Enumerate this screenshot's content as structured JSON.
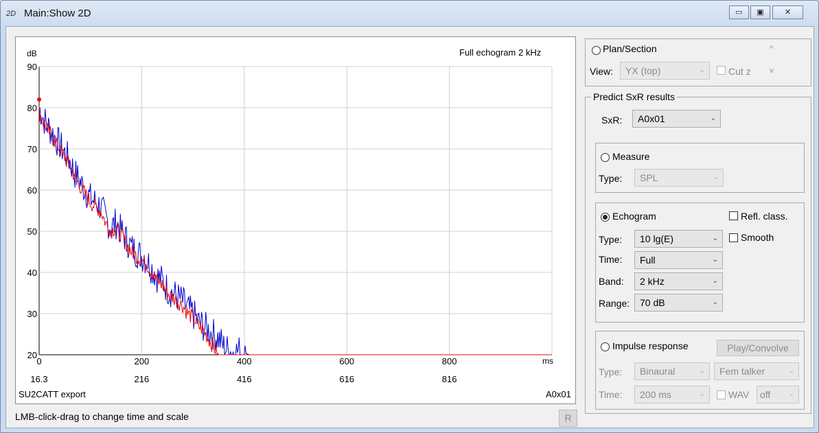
{
  "window": {
    "icon_label": "2D",
    "title": "Main:Show 2D",
    "buttons": {
      "minimize": "▭",
      "maximize": "▣",
      "close": "✕"
    }
  },
  "plot": {
    "title_right": "Full echogram  2 kHz",
    "y_unit": "dB",
    "x_unit": "ms",
    "lower_axis_labels": [
      "16.3",
      "216",
      "416",
      "616",
      "816"
    ],
    "bottom_left_label": "SU2CATT export",
    "bottom_right_label": "A0x01"
  },
  "status": {
    "hint": "LMB-click-drag to change time and scale",
    "r_button": "R"
  },
  "panel": {
    "plan_section": {
      "label": "Plan/Section",
      "view_label": "View:",
      "view_value": "YX (top)",
      "cutz_label": "Cut z",
      "scroll_up": "^",
      "scroll_down": "v"
    },
    "predict": {
      "title": "Predict SxR results",
      "sxr_label": "SxR:",
      "sxr_value": "A0x01"
    },
    "measure": {
      "label": "Measure",
      "type_label": "Type:",
      "type_value": "SPL"
    },
    "echogram": {
      "label": "Echogram",
      "refl_label": "Refl. class.",
      "smooth_label": "Smooth",
      "type_label": "Type:",
      "type_value": "10 lg(E)",
      "time_label": "Time:",
      "time_value": "Full",
      "band_label": "Band:",
      "band_value": "2 kHz",
      "range_label": "Range:",
      "range_value": "70 dB"
    },
    "impulse": {
      "label": "Impulse response",
      "play_button": "Play/Convolve",
      "type_label": "Type:",
      "type_value": "Binaural",
      "talker_value": "Fem talker",
      "time_label": "Time:",
      "time_value": "200 ms",
      "wav_label": "WAV",
      "wav_value": "off"
    }
  },
  "chart_data": {
    "type": "line",
    "title": "Full echogram  2 kHz",
    "xlabel": "ms",
    "ylabel": "dB",
    "xlim": [
      0,
      1000
    ],
    "ylim": [
      20,
      90
    ],
    "x_ticks": [
      0,
      200,
      400,
      600,
      800
    ],
    "y_ticks": [
      20,
      30,
      40,
      50,
      60,
      70,
      80,
      90
    ],
    "grid": true,
    "colors": {
      "blue_series": "#0000cc",
      "red_series": "#ee0000"
    },
    "peak_marker": {
      "x": 0,
      "y": 82
    },
    "series": [
      {
        "color": "#0000cc",
        "x": [
          0,
          10,
          20,
          30,
          40,
          50,
          60,
          70,
          80,
          90,
          100,
          110,
          120,
          130,
          140,
          150,
          160,
          170,
          180,
          190,
          200,
          210,
          220,
          230,
          240,
          250,
          260,
          270,
          280,
          290,
          300,
          310,
          320,
          330,
          340,
          350,
          360,
          370,
          380,
          390,
          400,
          410
        ],
        "y": [
          80,
          77,
          75,
          73,
          71,
          69,
          67,
          64,
          62,
          60,
          58,
          57,
          56,
          53,
          51,
          52,
          50,
          48,
          46,
          45,
          44,
          43,
          41,
          39,
          38,
          36,
          35,
          34,
          33,
          31,
          30,
          28,
          27,
          26,
          25,
          24,
          22,
          21,
          20.5,
          21,
          20.5,
          20
        ]
      },
      {
        "color": "#ee0000",
        "x": [
          0,
          10,
          20,
          30,
          40,
          50,
          60,
          70,
          80,
          90,
          100,
          110,
          120,
          130,
          140,
          150,
          160,
          170,
          180,
          190,
          200,
          210,
          220,
          230,
          240,
          250,
          260,
          270,
          280,
          290,
          300,
          310,
          320,
          330,
          340,
          350,
          400,
          500,
          600,
          700,
          800,
          900,
          1000
        ],
        "y": [
          79,
          76,
          74,
          72,
          70,
          68,
          66,
          63,
          61,
          59,
          57,
          56,
          55,
          52,
          50,
          51,
          49,
          47,
          45,
          44,
          43,
          42,
          40,
          38,
          37,
          35,
          34,
          33,
          32,
          30,
          29,
          27,
          26,
          24,
          22,
          20,
          20,
          20,
          20,
          20,
          20,
          20,
          20
        ]
      }
    ]
  }
}
